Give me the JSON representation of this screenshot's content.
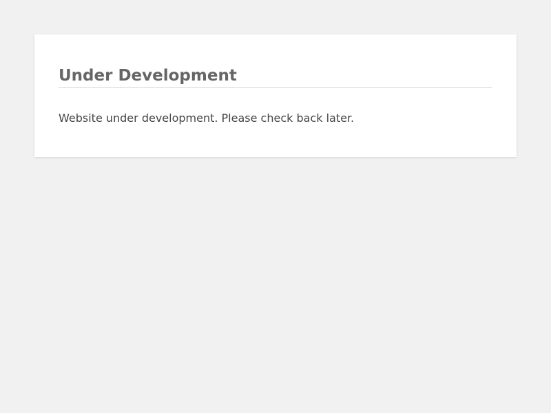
{
  "notice": {
    "title": "Under Development",
    "message": "Website under development. Please check back later."
  }
}
